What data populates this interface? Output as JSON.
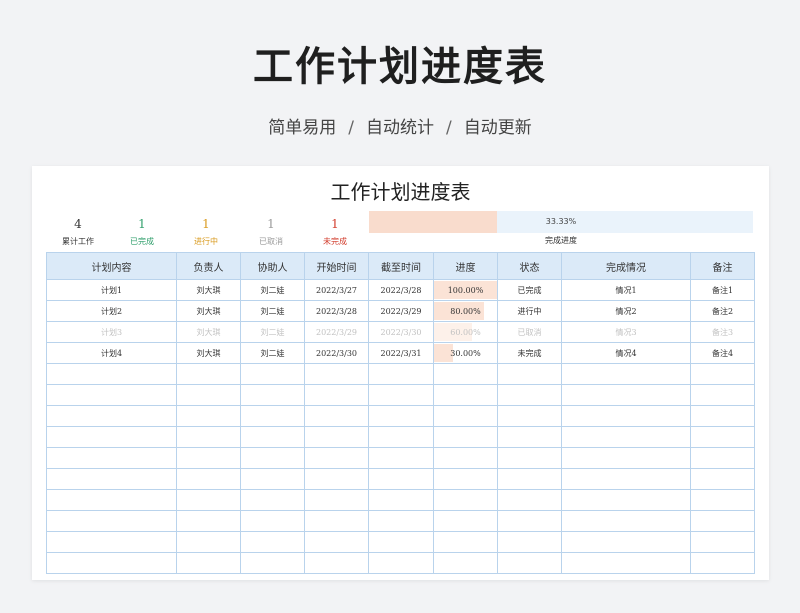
{
  "header": {
    "title": "工作计划进度表",
    "subtitle_parts": [
      "简单易用",
      "自动统计",
      "自动更新"
    ],
    "separator": "/"
  },
  "sheet": {
    "title": "工作计划进度表",
    "stats": [
      {
        "value": "4",
        "label": "累计工作",
        "color": "#333333"
      },
      {
        "value": "1",
        "label": "已完成",
        "color": "#2e9e6a"
      },
      {
        "value": "1",
        "label": "进行中",
        "color": "#d99a1e"
      },
      {
        "value": "1",
        "label": "已取消",
        "color": "#9a9a9a"
      },
      {
        "value": "1",
        "label": "未完成",
        "color": "#d23c2c"
      }
    ],
    "overall_progress": {
      "value": 0.3333,
      "text": "33.33%",
      "label": "完成进度"
    },
    "columns": [
      "计划内容",
      "负责人",
      "协助人",
      "开始时间",
      "截至时间",
      "进度",
      "状态",
      "完成情况",
      "备注"
    ],
    "rows": [
      {
        "plan": "计划1",
        "owner": "刘大琪",
        "assist": "刘二娃",
        "start": "2022/3/27",
        "end": "2022/3/28",
        "progress": 1.0,
        "progress_text": "100.00%",
        "status": "已完成",
        "result": "情况1",
        "note": "备注1"
      },
      {
        "plan": "计划2",
        "owner": "刘大琪",
        "assist": "刘二娃",
        "start": "2022/3/28",
        "end": "2022/3/29",
        "progress": 0.8,
        "progress_text": "80.00%",
        "status": "进行中",
        "result": "情况2",
        "note": "备注2"
      },
      {
        "plan": "计划3",
        "owner": "刘大琪",
        "assist": "刘二娃",
        "start": "2022/3/29",
        "end": "2022/3/30",
        "progress": 0.6,
        "progress_text": "60.00%",
        "status": "已取消",
        "result": "情况3",
        "note": "备注3"
      },
      {
        "plan": "计划4",
        "owner": "刘大琪",
        "assist": "刘二娃",
        "start": "2022/3/30",
        "end": "2022/3/31",
        "progress": 0.3,
        "progress_text": "30.00%",
        "status": "未完成",
        "result": "情况4",
        "note": "备注4"
      }
    ],
    "empty_row_count": 10
  }
}
